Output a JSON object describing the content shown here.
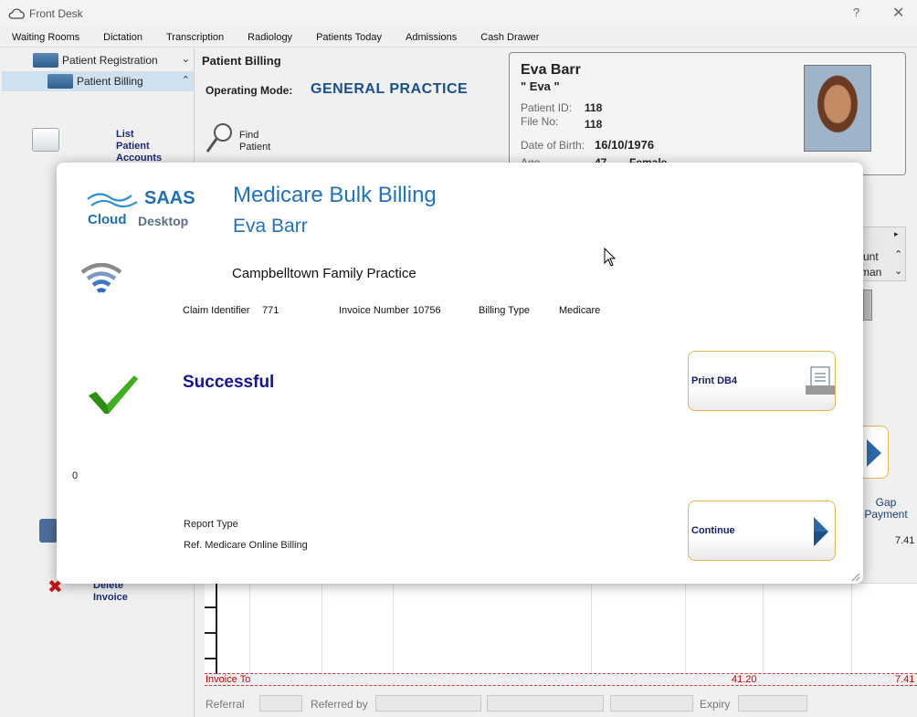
{
  "window": {
    "title": "Front Desk",
    "help": "?",
    "close": "✕"
  },
  "menu": [
    "Waiting Rooms",
    "Dictation",
    "Transcription",
    "Radiology",
    "Patients Today",
    "Admissions",
    "Cash Drawer"
  ],
  "sidebar": {
    "patient_registration": "Patient Registration",
    "patient_billing": "Patient Billing",
    "list_patient_accounts": [
      "List",
      "Patient",
      "Accounts"
    ],
    "delete_invoice": [
      "Delete",
      "Invoice"
    ]
  },
  "billing": {
    "section_title": "Patient Billing",
    "operating_mode_label": "Operating Mode:",
    "operating_mode_value": "GENERAL PRACTICE",
    "find_patient": [
      "Find",
      "Patient"
    ]
  },
  "patient": {
    "name": "Eva Barr",
    "nickname": "\" Eva \"",
    "patient_id_label": "Patient ID:",
    "patient_id": "118",
    "file_no_label": "File No:",
    "file_no": "118",
    "dob_label": "Date of Birth:",
    "dob": "16/10/1976",
    "age_label": "Age",
    "age": "47",
    "sex": "Female"
  },
  "background": {
    "col_count_partial": "unt",
    "col_man_partial": "man",
    "gap_payment": [
      "Gap",
      "Payment"
    ],
    "gap_value": "7.41",
    "invoice_total_label": "Invoice To",
    "invoice_total_amount": "41.20",
    "invoice_total_gap": "7.41",
    "referral_label": "Referral",
    "referred_by_label": "Referred by",
    "expiry_label": "Expiry"
  },
  "modal": {
    "logo_line1": "SAAS",
    "logo_line2_a": "Cloud",
    "logo_line2_b": "Desktop",
    "title": "Medicare Bulk Billing",
    "patient_name": "Eva Barr",
    "practice": "Campbelltown Family Practice",
    "claim_identifier_label": "Claim Identifier",
    "claim_identifier": "771",
    "invoice_number_label": "Invoice Number",
    "invoice_number": "10756",
    "billing_type_label": "Billing Type",
    "billing_type": "Medicare",
    "status": "Successful",
    "count": "0",
    "report_type_label": "Report Type",
    "report_ref": "Ref. Medicare Online Billing",
    "print_button": "Print DB4",
    "continue_button": "Continue"
  },
  "colors": {
    "accent": "#1f72c4",
    "status": "#141496",
    "button_border": "#e6b750",
    "check": "#3fae1f"
  }
}
